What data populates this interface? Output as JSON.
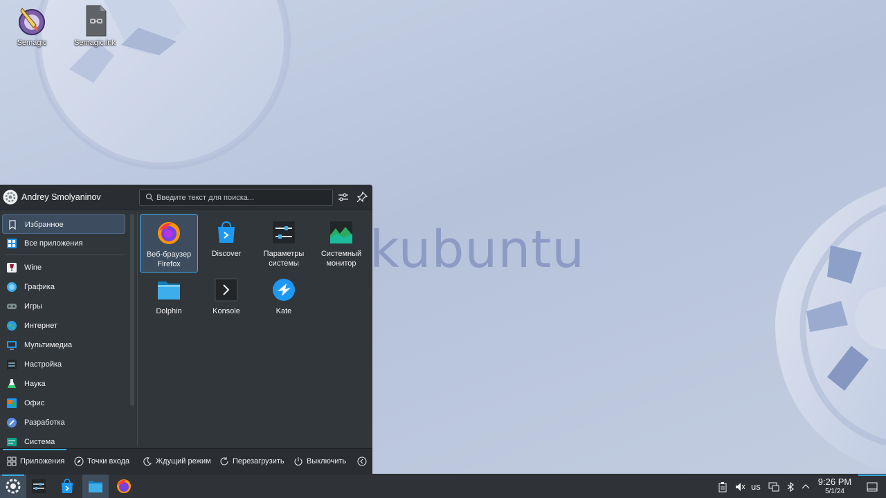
{
  "desktop": {
    "brand_text": "kubuntu",
    "icons": [
      {
        "label": "Semagic",
        "icon": "semagic-quill-icon"
      },
      {
        "label": "Semagic.lnk",
        "icon": "shortcut-file-icon"
      }
    ]
  },
  "launcher": {
    "user_name": "Andrey Smolyaninov",
    "search_placeholder": "Введите текст для поиска...",
    "sidebar": [
      {
        "label": "Избранное",
        "icon": "bookmark-icon",
        "active": true
      },
      {
        "label": "Все приложения",
        "icon": "grid-icon"
      },
      {
        "label": "Wine",
        "icon": "wine-glass-icon"
      },
      {
        "label": "Графика",
        "icon": "graphics-icon"
      },
      {
        "label": "Игры",
        "icon": "gamepad-icon"
      },
      {
        "label": "Интернет",
        "icon": "globe-icon"
      },
      {
        "label": "Мультимедиа",
        "icon": "multimedia-icon"
      },
      {
        "label": "Настройка",
        "icon": "settings-icon"
      },
      {
        "label": "Наука",
        "icon": "science-flask-icon"
      },
      {
        "label": "Офис",
        "icon": "office-icon"
      },
      {
        "label": "Разработка",
        "icon": "development-icon"
      },
      {
        "label": "Система",
        "icon": "system-icon"
      }
    ],
    "favorites": [
      {
        "label": "Веб-браузер Firefox",
        "icon": "firefox-icon",
        "active": true
      },
      {
        "label": "Discover",
        "icon": "discover-icon"
      },
      {
        "label": "Параметры системы",
        "icon": "system-settings-icon"
      },
      {
        "label": "Системный монитор",
        "icon": "system-monitor-icon"
      },
      {
        "label": "Dolphin",
        "icon": "dolphin-folder-icon"
      },
      {
        "label": "Konsole",
        "icon": "konsole-terminal-icon"
      },
      {
        "label": "Kate",
        "icon": "kate-editor-icon"
      }
    ],
    "footer": {
      "applications": "Приложения",
      "places": "Точки входа",
      "sleep": "Ждущий режим",
      "restart": "Перезагрузить",
      "shutdown": "Выключить"
    }
  },
  "taskbar": {
    "tasks": [
      {
        "name": "application-launcher",
        "icon": "kde-launcher-icon"
      },
      {
        "name": "system-settings",
        "icon": "system-settings-icon"
      },
      {
        "name": "discover",
        "icon": "discover-icon"
      },
      {
        "name": "dolphin",
        "icon": "dolphin-folder-icon"
      },
      {
        "name": "firefox",
        "icon": "firefox-icon"
      }
    ],
    "keyboard_layout": "us",
    "time": "9:26 PM",
    "date": "5/1/24"
  },
  "colors": {
    "accent": "#3daee9",
    "panel": "#31363b",
    "wallpaper": "#b5c2da",
    "brand_text": "#8d9bc4"
  }
}
